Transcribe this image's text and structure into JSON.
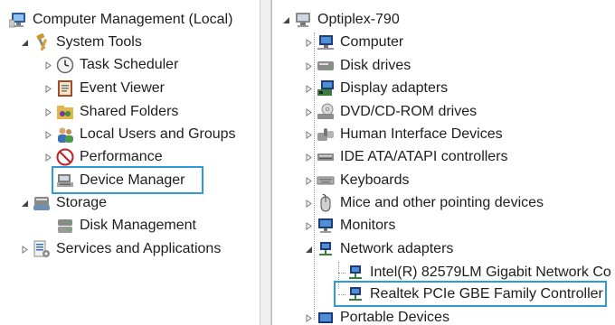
{
  "left_tree": {
    "root": "Computer Management (Local)",
    "system_tools": "System Tools",
    "task_scheduler": "Task Scheduler",
    "event_viewer": "Event Viewer",
    "shared_folders": "Shared Folders",
    "local_users": "Local Users and Groups",
    "performance": "Performance",
    "device_manager": "Device Manager",
    "storage": "Storage",
    "disk_management": "Disk Management",
    "services": "Services and Applications"
  },
  "right_tree": {
    "root": "Optiplex-790",
    "computer": "Computer",
    "disk_drives": "Disk drives",
    "display_adapters": "Display adapters",
    "dvd_drives": "DVD/CD-ROM drives",
    "hid": "Human Interface Devices",
    "ide": "IDE ATA/ATAPI controllers",
    "keyboards": "Keyboards",
    "mice": "Mice and other pointing devices",
    "monitors": "Monitors",
    "network_adapters": "Network adapters",
    "intel_nic": "Intel(R) 82579LM Gigabit Network Co",
    "realtek_nic": "Realtek PCIe GBE Family Controller",
    "portable_devices": "Portable Devices"
  },
  "colors": {
    "highlight_border": "#2f9bd6"
  }
}
